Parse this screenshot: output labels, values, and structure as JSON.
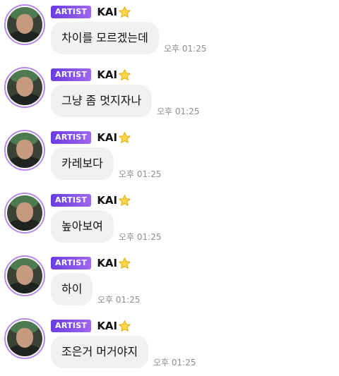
{
  "badge_label": "ARTIST",
  "sender_name": "KAI",
  "messages": [
    {
      "text": "차이를 모르겠는데",
      "time": "오후 01:25"
    },
    {
      "text": "그냥 좀 멋지자나",
      "time": "오후 01:25"
    },
    {
      "text": "카레보다",
      "time": "오후 01:25"
    },
    {
      "text": "높아보여",
      "time": "오후 01:25"
    },
    {
      "text": "하이",
      "time": "오후 01:25"
    },
    {
      "text": "조은거 머거야지",
      "time": "오후 01:25"
    }
  ],
  "colors": {
    "badge_start": "#6a3de0",
    "badge_end": "#a066f0",
    "bubble_bg": "#f1f1f2",
    "avatar_ring": "#b58ae8",
    "time_text": "#8e8e93"
  },
  "icons": {
    "star": "star-icon"
  }
}
